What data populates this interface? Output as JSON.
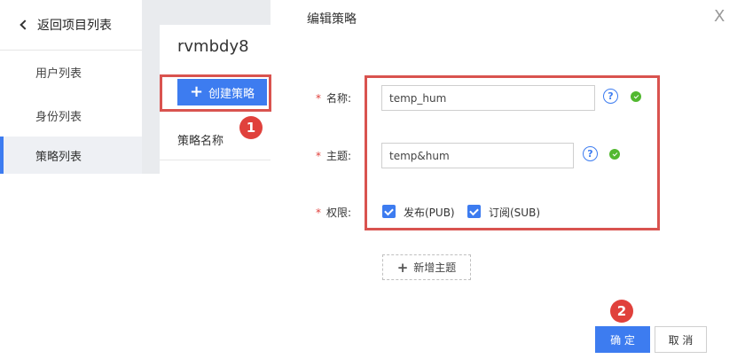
{
  "sidebar": {
    "back_label": "返回项目列表",
    "items": [
      {
        "label": "用户列表"
      },
      {
        "label": "身份列表"
      },
      {
        "label": "策略列表",
        "active": true
      }
    ]
  },
  "project": {
    "name": "rvmbdy8",
    "create_button_label": "创建策略",
    "column_header": "策略名称"
  },
  "annotations": {
    "step1": "1",
    "step2": "2"
  },
  "dialog": {
    "title": "编辑策略",
    "close_symbol": "X",
    "required_mark": "*",
    "fields": {
      "name": {
        "label": "名称:",
        "value": "temp_hum"
      },
      "topic": {
        "label": "主题:",
        "value": "temp&hum"
      },
      "permission": {
        "label": "权限:",
        "options": [
          {
            "label": "发布(PUB)",
            "checked": true
          },
          {
            "label": "订阅(SUB)",
            "checked": true
          }
        ]
      }
    },
    "help_symbol": "?",
    "add_topic_label": "新增主题",
    "ok_label": "确 定",
    "cancel_label": "取 消"
  },
  "colors": {
    "accent": "#3d7cf0",
    "highlight": "#d9534f",
    "success": "#52b830"
  }
}
